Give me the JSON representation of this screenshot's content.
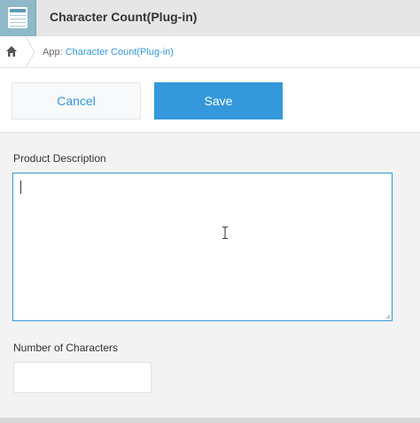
{
  "header": {
    "title": "Character Count(Plug-in)",
    "icon": "spreadsheet-app-icon"
  },
  "breadcrumb": {
    "home_icon": "home-icon",
    "prefix": "App: ",
    "link": "Character Count(Plug-in)"
  },
  "toolbar": {
    "cancel_label": "Cancel",
    "save_label": "Save"
  },
  "form": {
    "description": {
      "label": "Product Description",
      "value": ""
    },
    "character_count": {
      "label": "Number of Characters",
      "value": ""
    }
  },
  "colors": {
    "accent": "#3498db",
    "header_bg": "#e6e6e6",
    "page_bg": "#f3f3f3"
  }
}
